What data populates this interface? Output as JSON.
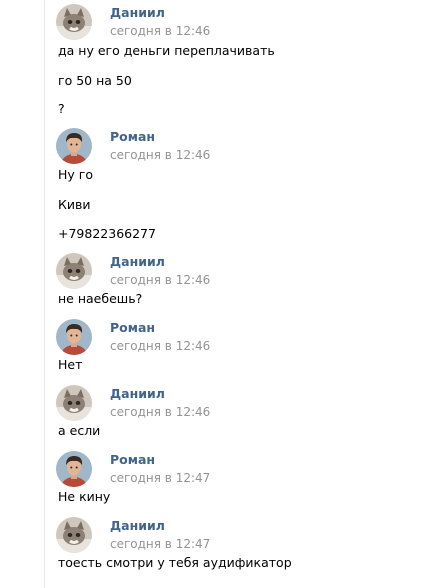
{
  "messages": [
    {
      "author": "Даниил",
      "time": "сегодня в 12:46",
      "avatar": "cat-avatar",
      "lines": [
        "да ну его деньги переплачивать",
        "го 50 на 50",
        "?"
      ]
    },
    {
      "author": "Роман",
      "time": "сегодня в 12:46",
      "avatar": "boy-avatar",
      "lines": [
        "Ну го",
        "Киви",
        "+79822366277"
      ]
    },
    {
      "author": "Даниил",
      "time": "сегодня в 12:46",
      "avatar": "cat-avatar",
      "lines": [
        "не наебешь?"
      ]
    },
    {
      "author": "Роман",
      "time": "сегодня в 12:46",
      "avatar": "boy-avatar",
      "lines": [
        "Нет"
      ]
    },
    {
      "author": "Даниил",
      "time": "сегодня в 12:46",
      "avatar": "cat-avatar",
      "lines": [
        "а если"
      ]
    },
    {
      "author": "Роман",
      "time": "сегодня в 12:47",
      "avatar": "boy-avatar",
      "lines": [
        "Не кину"
      ]
    },
    {
      "author": "Даниил",
      "time": "сегодня в 12:47",
      "avatar": "cat-avatar",
      "lines": [
        "тоесть смотри у тебя аудификатор"
      ]
    }
  ]
}
